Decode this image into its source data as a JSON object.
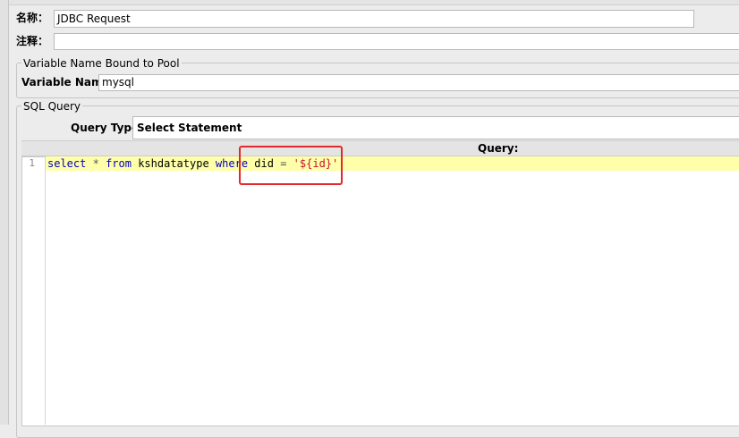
{
  "header": {
    "name_label": "名称：",
    "name_value": "JDBC Request",
    "comment_label": "注释：",
    "comment_value": ""
  },
  "pool_group": {
    "title": "Variable Name Bound to Pool",
    "var_label": "Variable Name:",
    "var_value": "mysql"
  },
  "sql_group": {
    "title": "SQL Query",
    "query_type_label": "Query Type:",
    "query_type_value": "Select Statement",
    "query_column_label": "Query:"
  },
  "editor": {
    "line_number": "1",
    "tokens": {
      "select": "select",
      "star": "*",
      "from": "from",
      "table": "kshdatatype",
      "where": "where",
      "column": "did",
      "equals": "=",
      "value": "'${id}'"
    }
  },
  "colors": {
    "keyword": "#0000c0",
    "string": "#c8102e",
    "current_line": "#ffffaa",
    "annotation": "#e32a2a"
  }
}
